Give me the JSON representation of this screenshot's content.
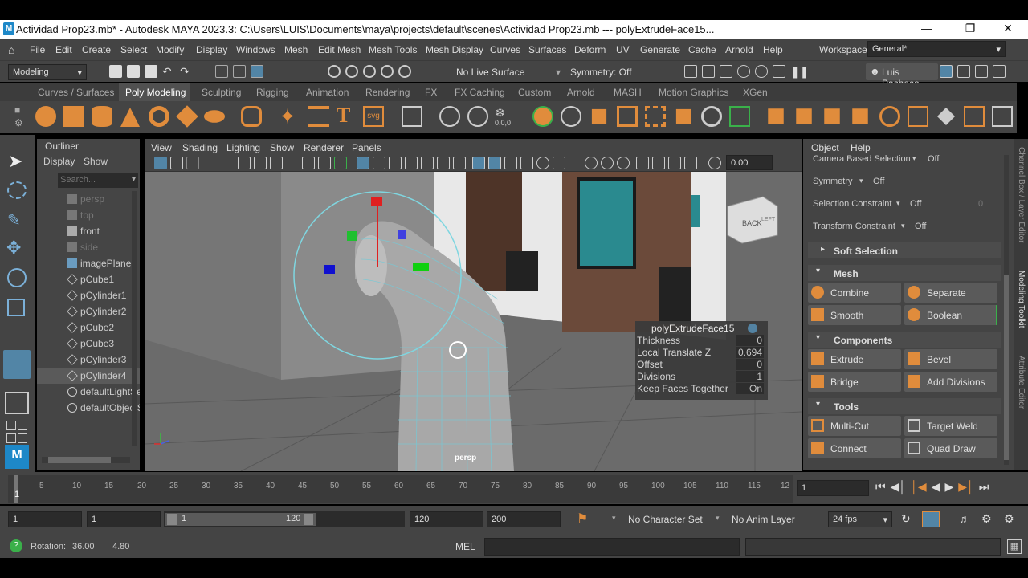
{
  "window": {
    "title": "Actividad Prop23.mb* - Autodesk MAYA 2023.3: C:\\Users\\LUIS\\Documents\\maya\\projects\\default\\scenes\\Actividad Prop23.mb   ---   polyExtrudeFace15..."
  },
  "menubar": {
    "items": [
      "File",
      "Edit",
      "Create",
      "Select",
      "Modify",
      "Display",
      "Windows",
      "Mesh",
      "Edit Mesh",
      "Mesh Tools",
      "Mesh Display",
      "Curves",
      "Surfaces",
      "Deform",
      "UV",
      "Generate",
      "Cache",
      "Arnold",
      "Help"
    ],
    "workspace_label": "Workspace:",
    "workspace_value": "General*"
  },
  "statusline": {
    "mode": "Modeling",
    "live_surface": "No Live Surface",
    "symmetry": "Symmetry: Off",
    "user": "Luis Pacheco"
  },
  "shelf": {
    "tabs": [
      "Curves / Surfaces",
      "Poly Modeling",
      "Sculpting",
      "Rigging",
      "Animation",
      "Rendering",
      "FX",
      "FX Caching",
      "Custom",
      "Arnold",
      "MASH",
      "Motion Graphics",
      "XGen"
    ],
    "active": "Poly Modeling",
    "svg_label": "svg",
    "coord_label": "0,0,0"
  },
  "outliner": {
    "title": "Outliner",
    "menu": [
      "Display",
      "Show"
    ],
    "search_placeholder": "Search...",
    "items": [
      {
        "name": "persp",
        "dim": true
      },
      {
        "name": "top",
        "dim": true
      },
      {
        "name": "front",
        "dim": false
      },
      {
        "name": "side",
        "dim": true
      },
      {
        "name": "imagePlane1",
        "dim": false
      },
      {
        "name": "pCube1",
        "dim": false
      },
      {
        "name": "pCylinder1",
        "dim": false
      },
      {
        "name": "pCylinder2",
        "dim": false
      },
      {
        "name": "pCube2",
        "dim": false
      },
      {
        "name": "pCube3",
        "dim": false
      },
      {
        "name": "pCylinder3",
        "dim": false
      },
      {
        "name": "pCylinder4",
        "dim": false
      },
      {
        "name": "defaultLightSet",
        "dim": false
      },
      {
        "name": "defaultObjectSet",
        "dim": false
      }
    ]
  },
  "viewport": {
    "menu": [
      "View",
      "Shading",
      "Lighting",
      "Show",
      "Renderer",
      "Panels"
    ],
    "camera_label": "persp",
    "value_field": "0.00",
    "viewcube_label": "BACK",
    "viewcube_side": "LEFT"
  },
  "hud": {
    "title": "polyExtrudeFace15",
    "rows": [
      {
        "label": "Thickness",
        "value": "0"
      },
      {
        "label": "Local Translate Z",
        "value": "0.694"
      },
      {
        "label": "Offset",
        "value": "0"
      },
      {
        "label": "Divisions",
        "value": "1"
      },
      {
        "label": "Keep Faces Together",
        "value": "On"
      }
    ]
  },
  "toolkit": {
    "menu": [
      "Object",
      "Help"
    ],
    "camera_based": "Camera Based Selection",
    "camera_based_val": "Off",
    "symmetry": "Symmetry",
    "symmetry_val": "Off",
    "sel_constraint": "Selection Constraint",
    "sel_constraint_val": "Off",
    "sel_constraint_num": "0",
    "transform_constraint": "Transform Constraint",
    "transform_constraint_val": "Off",
    "soft_selection": "Soft Selection",
    "mesh_header": "Mesh",
    "mesh_buttons": [
      "Combine",
      "Separate",
      "Smooth",
      "Boolean"
    ],
    "components_header": "Components",
    "component_buttons": [
      "Extrude",
      "Bevel",
      "Bridge",
      "Add Divisions"
    ],
    "tools_header": "Tools",
    "tool_buttons": [
      "Multi-Cut",
      "Target Weld",
      "Connect",
      "Quad Draw"
    ]
  },
  "sidetabs": [
    "Channel Box / Layer Editor",
    "Modeling Toolkit",
    "Attribute Editor"
  ],
  "timeline": {
    "ticks": [
      "1",
      "5",
      "10",
      "15",
      "20",
      "25",
      "30",
      "35",
      "40",
      "45",
      "50",
      "55",
      "60",
      "65",
      "70",
      "75",
      "80",
      "85",
      "90",
      "95",
      "100",
      "105",
      "110",
      "115",
      "12"
    ],
    "current_frame": "1"
  },
  "range": {
    "start": "1",
    "start2": "1",
    "slider_start": "1",
    "slider_end": "120",
    "end": "120",
    "end2": "200",
    "char_set": "No Character Set",
    "anim_layer": "No Anim Layer",
    "fps": "24 fps"
  },
  "cmd": {
    "status_label": "Rotation:",
    "status_v1": "36.00",
    "status_v2": "4.80",
    "mel": "MEL"
  },
  "colors": {
    "accent": "#5285a6",
    "shelf_icon": "#e08c3c",
    "hud_bg": "#3b3b3b"
  }
}
